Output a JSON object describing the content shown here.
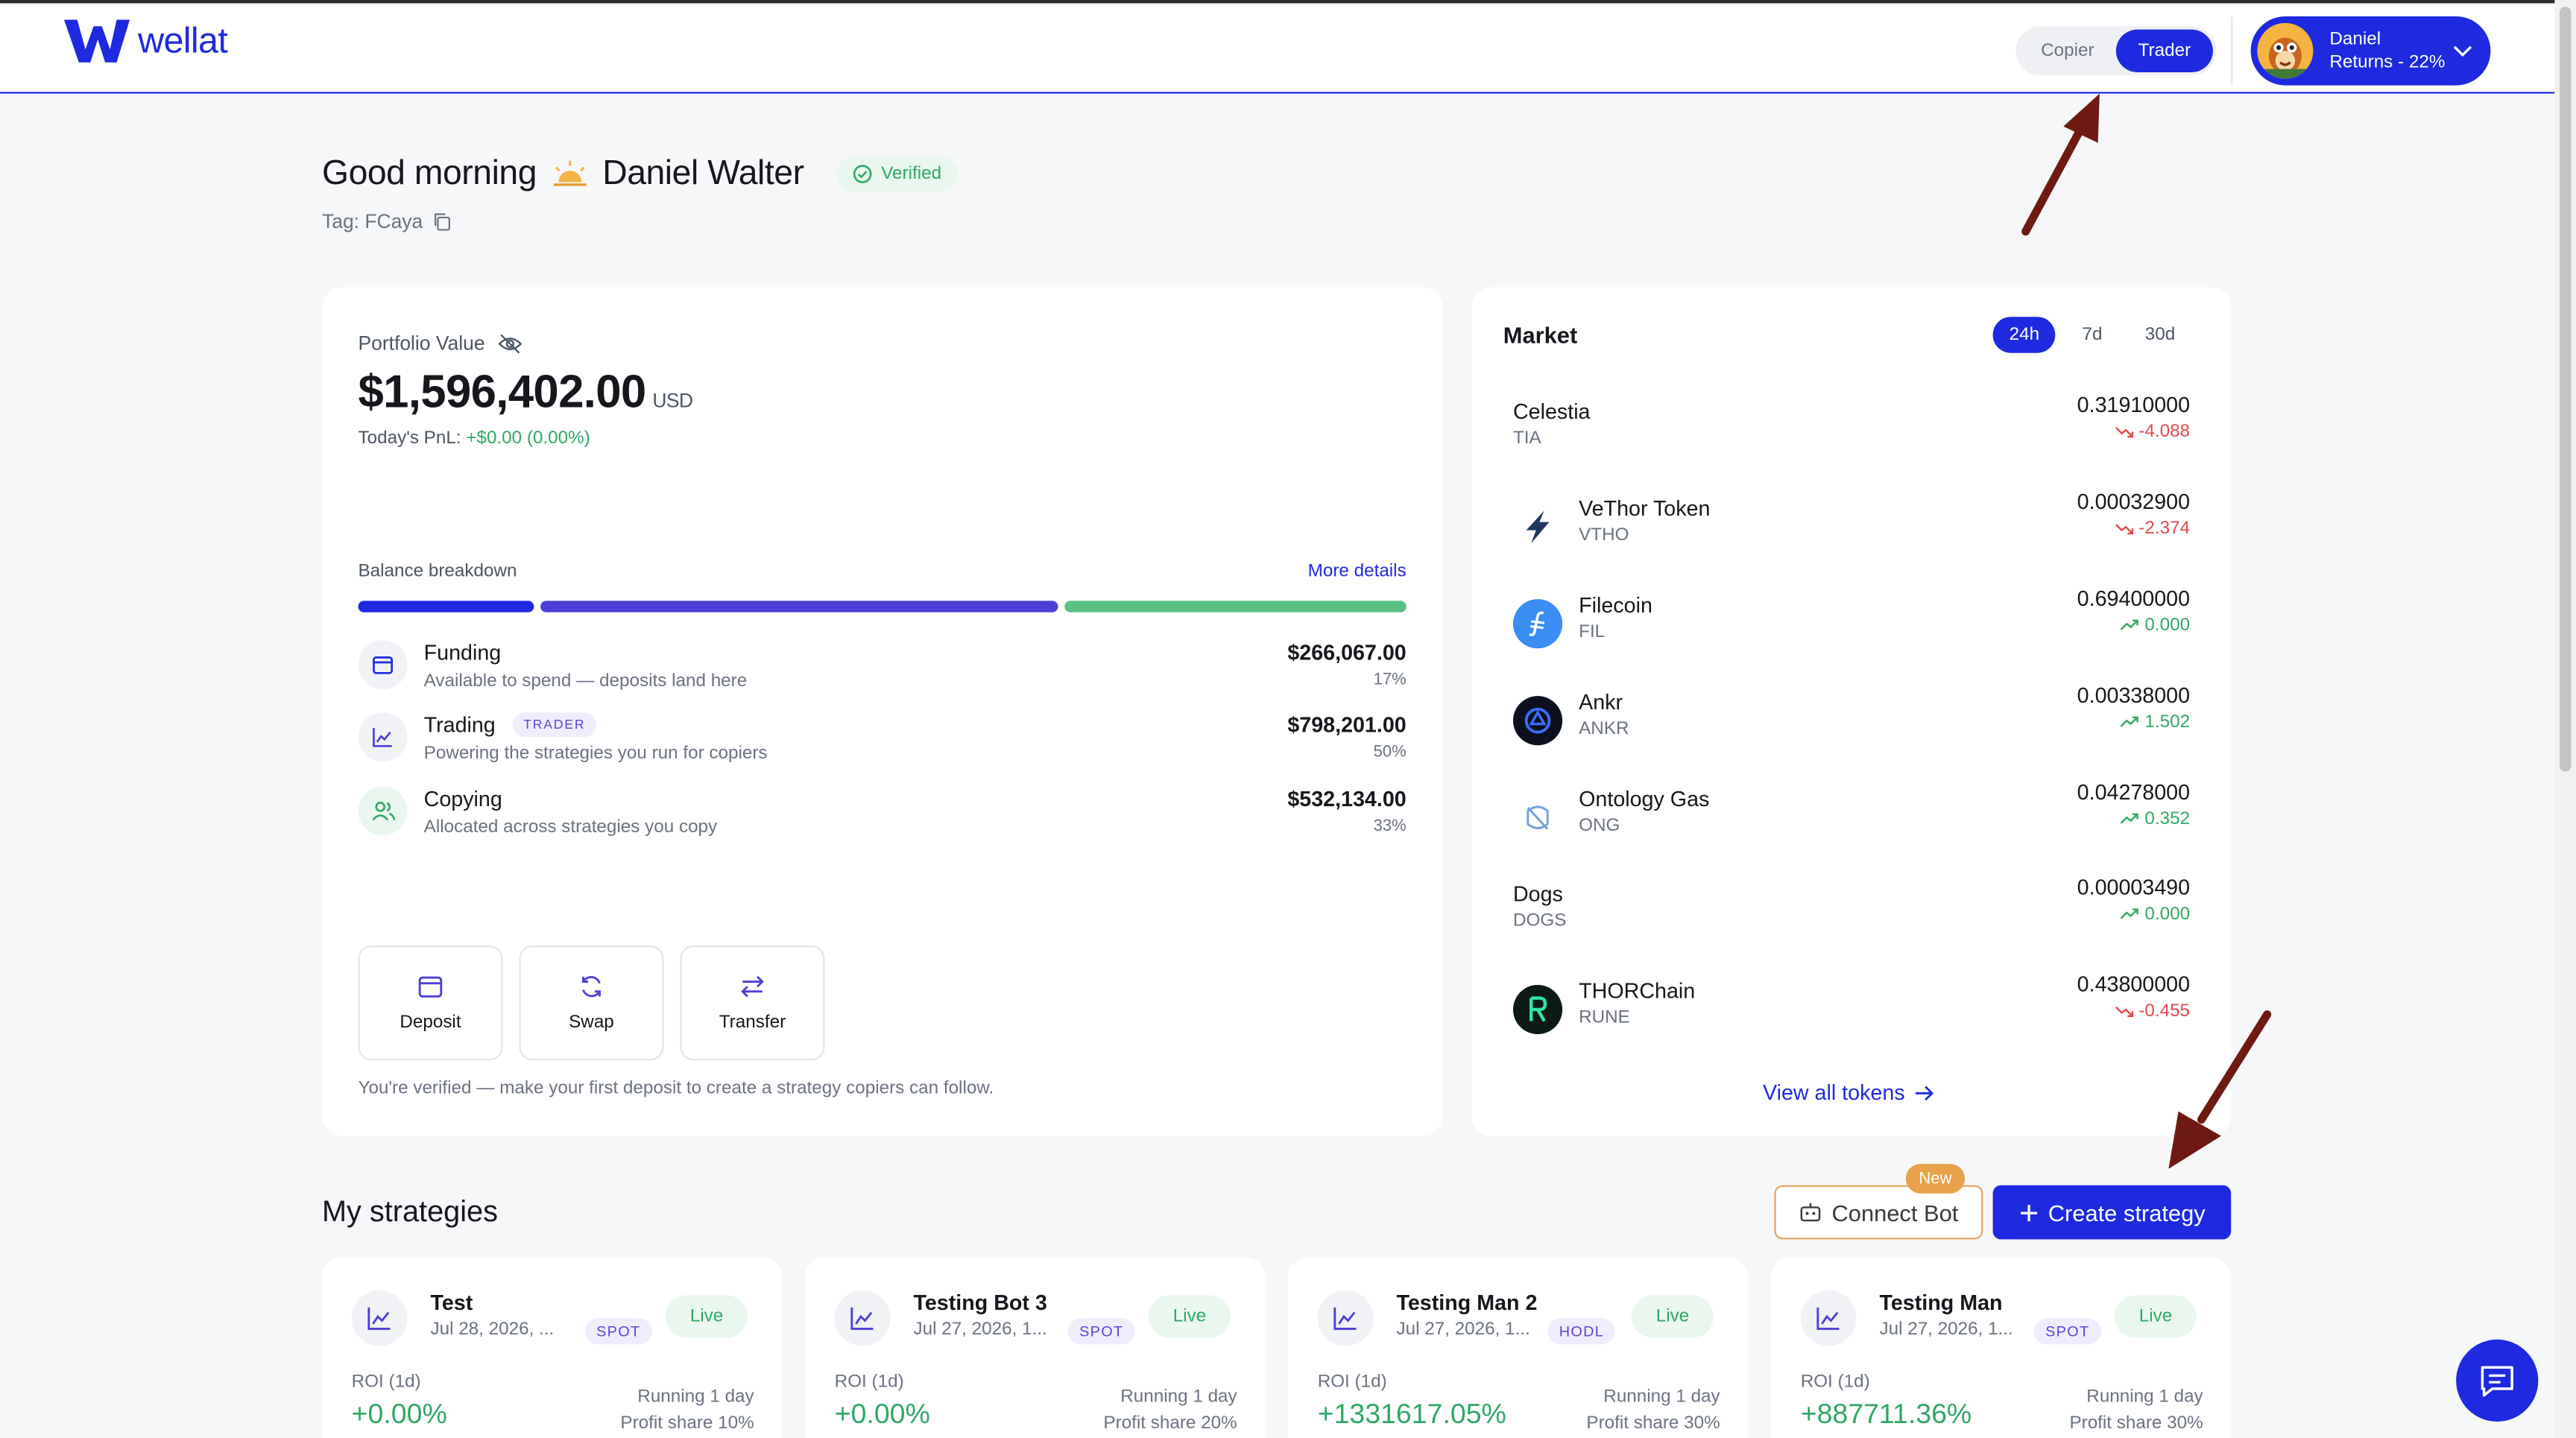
{
  "brand": {
    "name": "wellat",
    "accent": "#1d2ae0"
  },
  "header": {
    "roles": [
      {
        "label": "Copier",
        "active": false
      },
      {
        "label": "Trader",
        "active": true
      }
    ],
    "user": {
      "name": "Daniel",
      "returns": "Returns - 22%"
    }
  },
  "greeting": {
    "prefix": "Good morning",
    "icon": "sunrise-icon",
    "name": "Daniel Walter",
    "verified": "Verified",
    "tag": "Tag: FCaya"
  },
  "portfolio": {
    "label": "Portfolio Value",
    "value": "$1,596,402.00",
    "currency": "USD",
    "pnl_label": "Today's PnL: ",
    "pnl_value": "+$0.00 (0.00%)",
    "breakdown_label": "Balance breakdown",
    "more_details": "More details",
    "rows": [
      {
        "name": "Funding",
        "sub": "Available to spend — deposits land here",
        "amount": "$266,067.00",
        "pct": "17%",
        "share": 17,
        "color": "#1d2ae0"
      },
      {
        "name": "Trading",
        "badge": "TRADER",
        "sub": "Powering the strategies you run for copiers",
        "amount": "$798,201.00",
        "pct": "50%",
        "share": 50,
        "color": "#4d3fd6"
      },
      {
        "name": "Copying",
        "sub": "Allocated across strategies you copy",
        "amount": "$532,134.00",
        "pct": "33%",
        "share": 33,
        "color": "#5bc083"
      }
    ],
    "actions": [
      {
        "label": "Deposit"
      },
      {
        "label": "Swap"
      },
      {
        "label": "Transfer"
      }
    ],
    "footer": "You're verified — make your first deposit to create a strategy copiers can follow."
  },
  "market": {
    "title": "Market",
    "tabs": [
      {
        "label": "24h",
        "active": true
      },
      {
        "label": "7d",
        "active": false
      },
      {
        "label": "30d",
        "active": false
      }
    ],
    "tokens": [
      {
        "name": "Celestia",
        "symbol": "TIA",
        "price": "0.31910000",
        "change": "-4.088",
        "dir": "down"
      },
      {
        "name": "VeThor Token",
        "symbol": "VTHO",
        "price": "0.00032900",
        "change": "-2.374",
        "dir": "down"
      },
      {
        "name": "Filecoin",
        "symbol": "FIL",
        "price": "0.69400000",
        "change": "0.000",
        "dir": "up"
      },
      {
        "name": "Ankr",
        "symbol": "ANKR",
        "price": "0.00338000",
        "change": "1.502",
        "dir": "up"
      },
      {
        "name": "Ontology Gas",
        "symbol": "ONG",
        "price": "0.04278000",
        "change": "0.352",
        "dir": "up"
      },
      {
        "name": "Dogs",
        "symbol": "DOGS",
        "price": "0.00003490",
        "change": "0.000",
        "dir": "up"
      },
      {
        "name": "THORChain",
        "symbol": "RUNE",
        "price": "0.43800000",
        "change": "-0.455",
        "dir": "down"
      }
    ],
    "view_all": "View all tokens"
  },
  "strategies": {
    "title": "My strategies",
    "connect_bot": "Connect Bot",
    "new_badge": "New",
    "create": "Create strategy",
    "cards": [
      {
        "name": "Test",
        "date": "Jul 28, 2026, ...",
        "type": "SPOT",
        "status": "Live",
        "roi_label": "ROI (1d)",
        "roi": "+0.00%",
        "running": "Running 1 day",
        "share": "Profit share 10%"
      },
      {
        "name": "Testing Bot 3",
        "date": "Jul 27, 2026, 1...",
        "type": "SPOT",
        "status": "Live",
        "roi_label": "ROI (1d)",
        "roi": "+0.00%",
        "running": "Running 1 day",
        "share": "Profit share 20%"
      },
      {
        "name": "Testing Man 2",
        "date": "Jul 27, 2026, 1...",
        "type": "HODL",
        "status": "Live",
        "roi_label": "ROI (1d)",
        "roi": "+1331617.05%",
        "running": "Running 1 day",
        "share": "Profit share 30%"
      },
      {
        "name": "Testing Man",
        "date": "Jul 27, 2026, 1...",
        "type": "SPOT",
        "status": "Live",
        "roi_label": "ROI (1d)",
        "roi": "+887711.36%",
        "running": "Running 1 day",
        "share": "Profit share 30%"
      }
    ]
  }
}
